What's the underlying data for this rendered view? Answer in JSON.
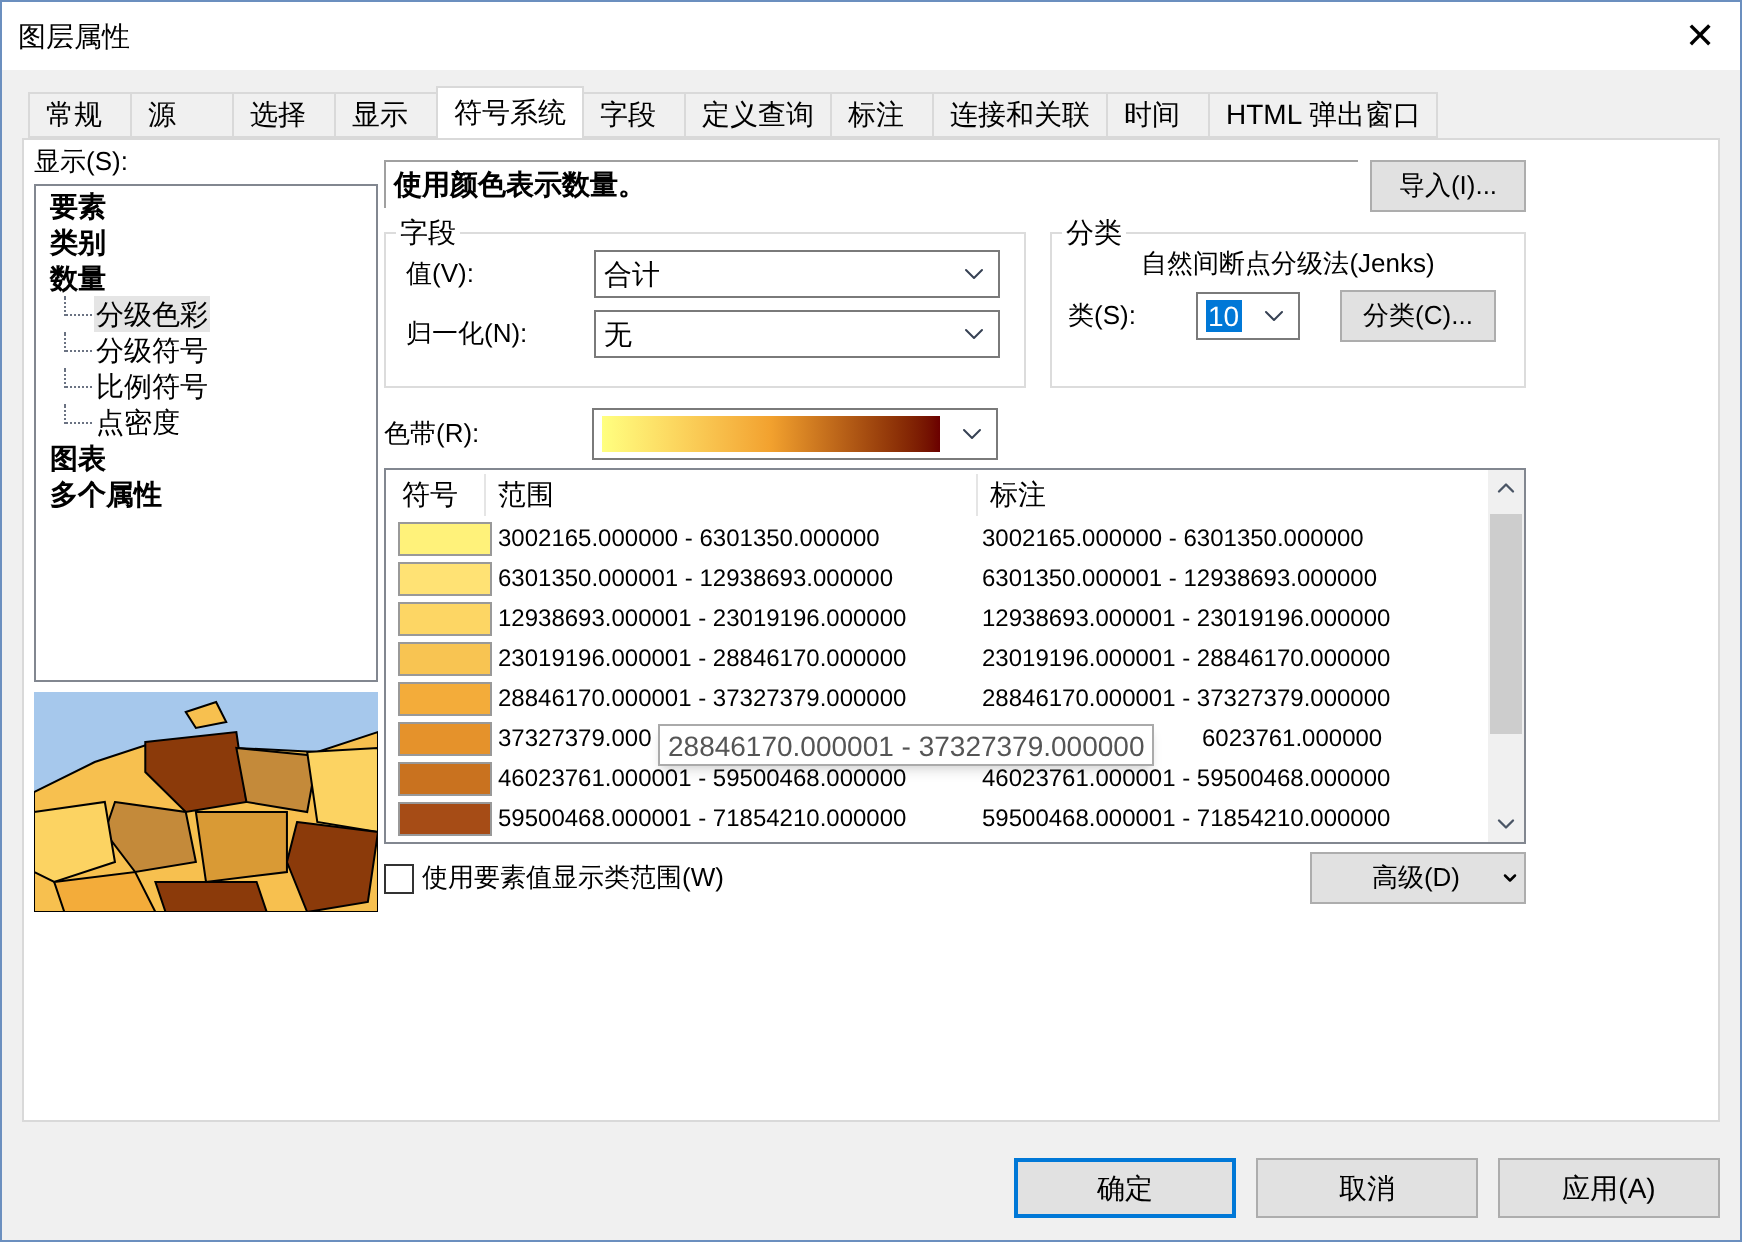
{
  "window": {
    "title": "图层属性",
    "close": "✕"
  },
  "tabs": [
    {
      "label": "常规",
      "selected": false
    },
    {
      "label": "源",
      "selected": false
    },
    {
      "label": "选择",
      "selected": false
    },
    {
      "label": "显示",
      "selected": false
    },
    {
      "label": "符号系统",
      "selected": true
    },
    {
      "label": "字段",
      "selected": false
    },
    {
      "label": "定义查询",
      "selected": false
    },
    {
      "label": "标注",
      "selected": false
    },
    {
      "label": "连接和关联",
      "selected": false
    },
    {
      "label": "时间",
      "selected": false
    },
    {
      "label": "HTML 弹出窗口",
      "selected": false
    }
  ],
  "show_label": "显示(S):",
  "tree": [
    {
      "label": "要素",
      "selected": false
    },
    {
      "label": "类别",
      "selected": false
    },
    {
      "label": "数量",
      "selected": false,
      "children": [
        {
          "label": "分级色彩",
          "selected": true
        },
        {
          "label": "分级符号",
          "selected": false
        },
        {
          "label": "比例符号",
          "selected": false
        },
        {
          "label": "点密度",
          "selected": false
        }
      ]
    },
    {
      "label": "图表",
      "selected": false
    },
    {
      "label": "多个属性",
      "selected": false
    }
  ],
  "preview": {
    "kind": "picture"
  },
  "description": "使用颜色表示数量。",
  "import_button": "导入(I)...",
  "field_group": {
    "title": "字段",
    "value_label": "值(V):",
    "value": "合计",
    "normalize_label": "归一化(N):",
    "normalize": "无"
  },
  "classification": {
    "title": "分类",
    "method": "自然间断点分级法(Jenks)",
    "classes_label": "类(S):",
    "classes": "10",
    "classify_button": "分类(C)..."
  },
  "color_ramp": {
    "label": "色带(R):"
  },
  "table": {
    "columns": [
      "符号",
      "范围",
      "标注"
    ],
    "rows": [
      {
        "color": "#fff27a",
        "range": "3002165.000000 - 6301350.000000",
        "label": "3002165.000000 - 6301350.000000",
        "covered": false
      },
      {
        "color": "#ffe274",
        "range": "6301350.000001 - 12938693.000000",
        "label": "6301350.000001 - 12938693.000000",
        "covered": false
      },
      {
        "color": "#fdd664",
        "range": "12938693.000001 - 23019196.000000",
        "label": "12938693.000001 - 23019196.000000",
        "covered": false
      },
      {
        "color": "#f8c452",
        "range": "23019196.000001 - 28846170.000000",
        "label": "23019196.000001 - 28846170.000000",
        "covered": false
      },
      {
        "color": "#f3ac3a",
        "range": "28846170.000001 - 37327379.000000",
        "label": "28846170.000001 - 37327379.000000",
        "covered": false
      },
      {
        "color": "#e5922b",
        "range": "37327379.000",
        "label": "6023761.000000",
        "covered": true
      },
      {
        "color": "#c9721f",
        "range": "46023761.000001 - 59500468.000000",
        "label": "46023761.000001 - 59500468.000000",
        "covered": false
      },
      {
        "color": "#a64c16",
        "range": "59500468.000001 - 71854210.000000",
        "label": "59500468.000001 - 71854210.000000",
        "covered": false
      }
    ],
    "tooltip": "28846170.000001 - 37327379.000000"
  },
  "show_values": {
    "label": "使用要素值显示类范围(W)",
    "checked": false
  },
  "advanced_button": "高级(D)",
  "buttons": [
    "确定",
    "取消",
    "应用(A)"
  ]
}
